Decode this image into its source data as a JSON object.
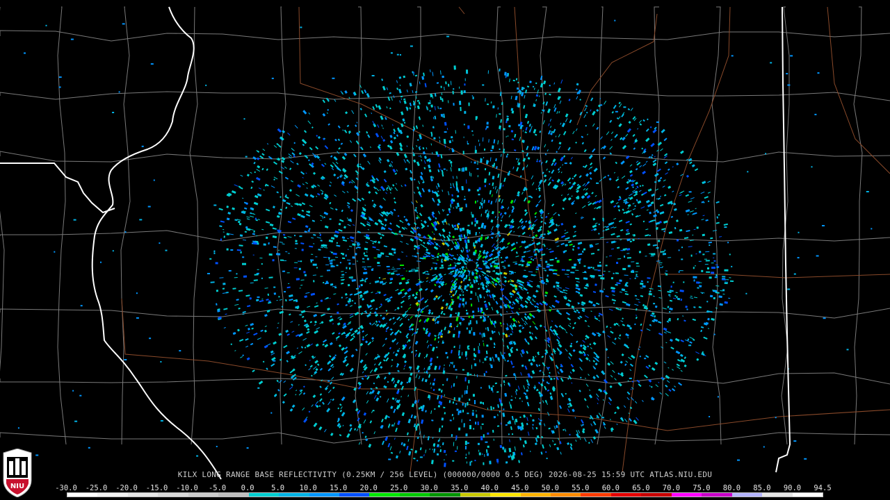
{
  "caption": "KILX LONG RANGE BASE REFLECTIVITY (0.25KM / 256 LEVEL) (000000/0000 0.5 DEG) 2026-08-25 15:59 UTC  ATLAS.NIU.EDU",
  "logo_text": "NIU",
  "colors": {
    "background": "#000000",
    "county_lines": "#7a7a7a",
    "state_lines": "#ffffff",
    "highways": "#8a4a2a",
    "radar_site": "#000000"
  },
  "scale": {
    "labels": [
      "-30.0",
      "-25.0",
      "-20.0",
      "-15.0",
      "-10.0",
      "-5.0",
      "0.0",
      "5.0",
      "10.0",
      "15.0",
      "20.0",
      "25.0",
      "30.0",
      "35.0",
      "40.0",
      "45.0",
      "50.0",
      "55.0",
      "60.0",
      "65.0",
      "70.0",
      "75.0",
      "80.0",
      "85.0",
      "90.0",
      "94.5"
    ],
    "colors": [
      "#ffffff",
      "#f2f2f2",
      "#e6e6e6",
      "#d9d9d9",
      "#cccccc",
      "#bfbfbf",
      "#00ced1",
      "#00b4e6",
      "#0096ff",
      "#0050ff",
      "#00e600",
      "#00c800",
      "#009600",
      "#c8c800",
      "#ffe600",
      "#ffb400",
      "#ff8c00",
      "#ff3c00",
      "#e60000",
      "#c80000",
      "#ff00ff",
      "#c800c8",
      "#b4b4ff",
      "#e6e6e6",
      "#ffffff"
    ]
  }
}
